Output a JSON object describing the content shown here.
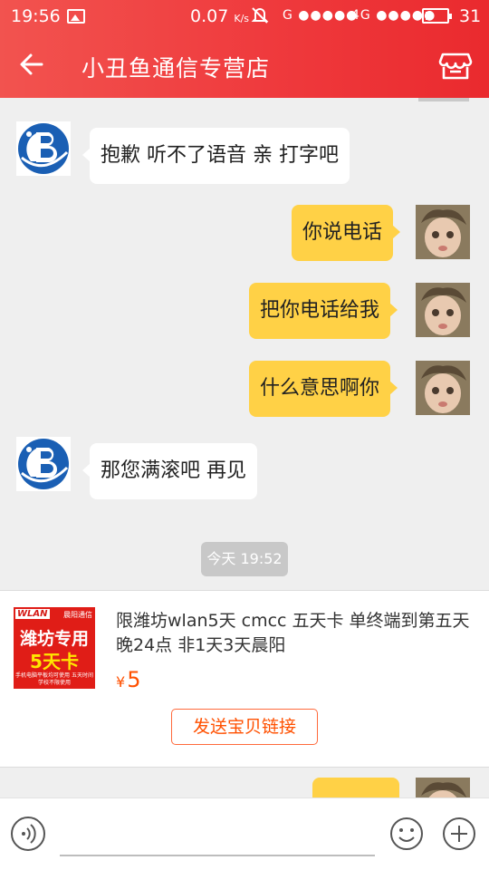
{
  "status_bar": {
    "time": "19:56",
    "net_speed": "0.07",
    "net_speed_unit": "K/s",
    "signal_1_label": "G",
    "signal_2_label": "4G",
    "battery": "31"
  },
  "nav": {
    "title": "小丑鱼通信专营店"
  },
  "messages": [
    {
      "side": "left",
      "text": "抱歉 听不了语音 亲 打字吧"
    },
    {
      "side": "right",
      "text": "你说电话"
    },
    {
      "side": "right",
      "text": "把你电话给我"
    },
    {
      "side": "right",
      "text": "什么意思啊你"
    },
    {
      "side": "left",
      "text": "那您满滚吧 再见"
    }
  ],
  "timestamp": "今天 19:52",
  "product": {
    "image_badge": "WLAN",
    "image_brand": "晨阳通信",
    "image_line1": "潍坊专用",
    "image_line2": "5天卡",
    "image_fine_print": "手机电脑平板均可使用 五天时间学校不限使用",
    "title": "限潍坊wlan5天 cmcc 五天卡 单终端到第五天晚24点 非1天3天晨阳",
    "currency": "¥",
    "price": "5",
    "send_button": "发送宝贝链接"
  },
  "colors": {
    "header_red": "#ef3a3d",
    "bubble_yellow": "#ffd146",
    "price_orange": "#ff5000"
  },
  "icons": {
    "back": "arrow-left-icon",
    "store": "store-icon",
    "voice": "voice-icon",
    "emoji": "emoji-icon",
    "plus": "plus-icon"
  }
}
